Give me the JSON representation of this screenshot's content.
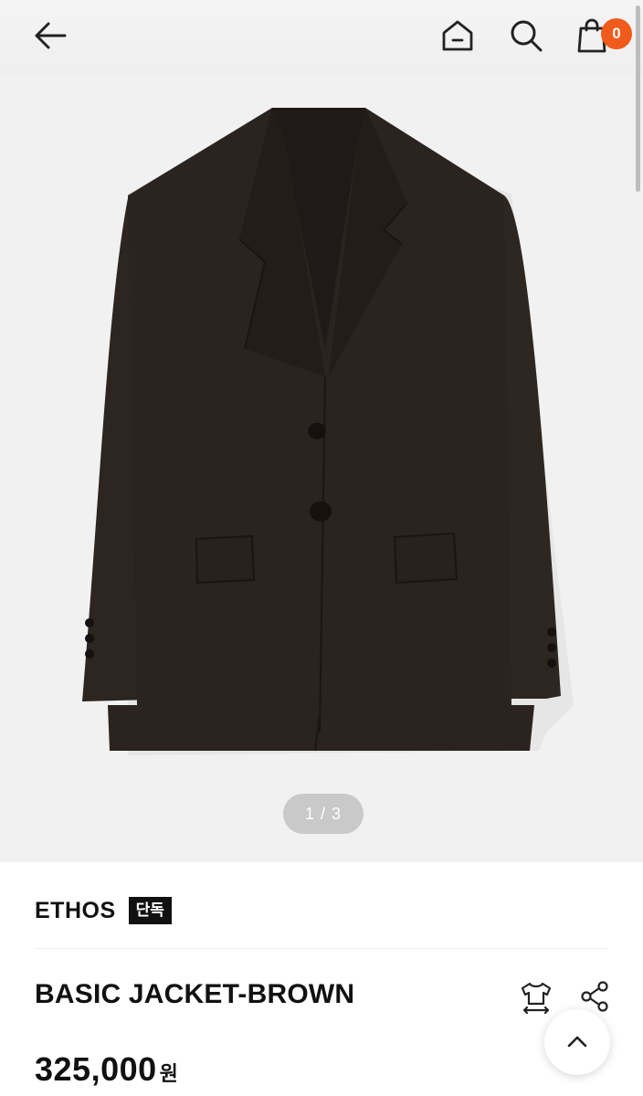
{
  "header": {
    "back_icon": "arrow-left-icon",
    "home_icon": "home-icon",
    "search_icon": "search-icon",
    "cart_icon": "shopping-bag-icon",
    "cart_count": "0",
    "badge_color": "#f05a1a"
  },
  "gallery": {
    "pager": "1 / 3"
  },
  "product": {
    "brand": "ETHOS",
    "exclusive_tag": "단독",
    "name": "BASIC JACKET-BROWN",
    "price": "325,000",
    "currency": "원",
    "size_icon": "size-guide-icon",
    "share_icon": "share-icon"
  },
  "floating": {
    "scroll_top_icon": "chevron-up-icon"
  }
}
